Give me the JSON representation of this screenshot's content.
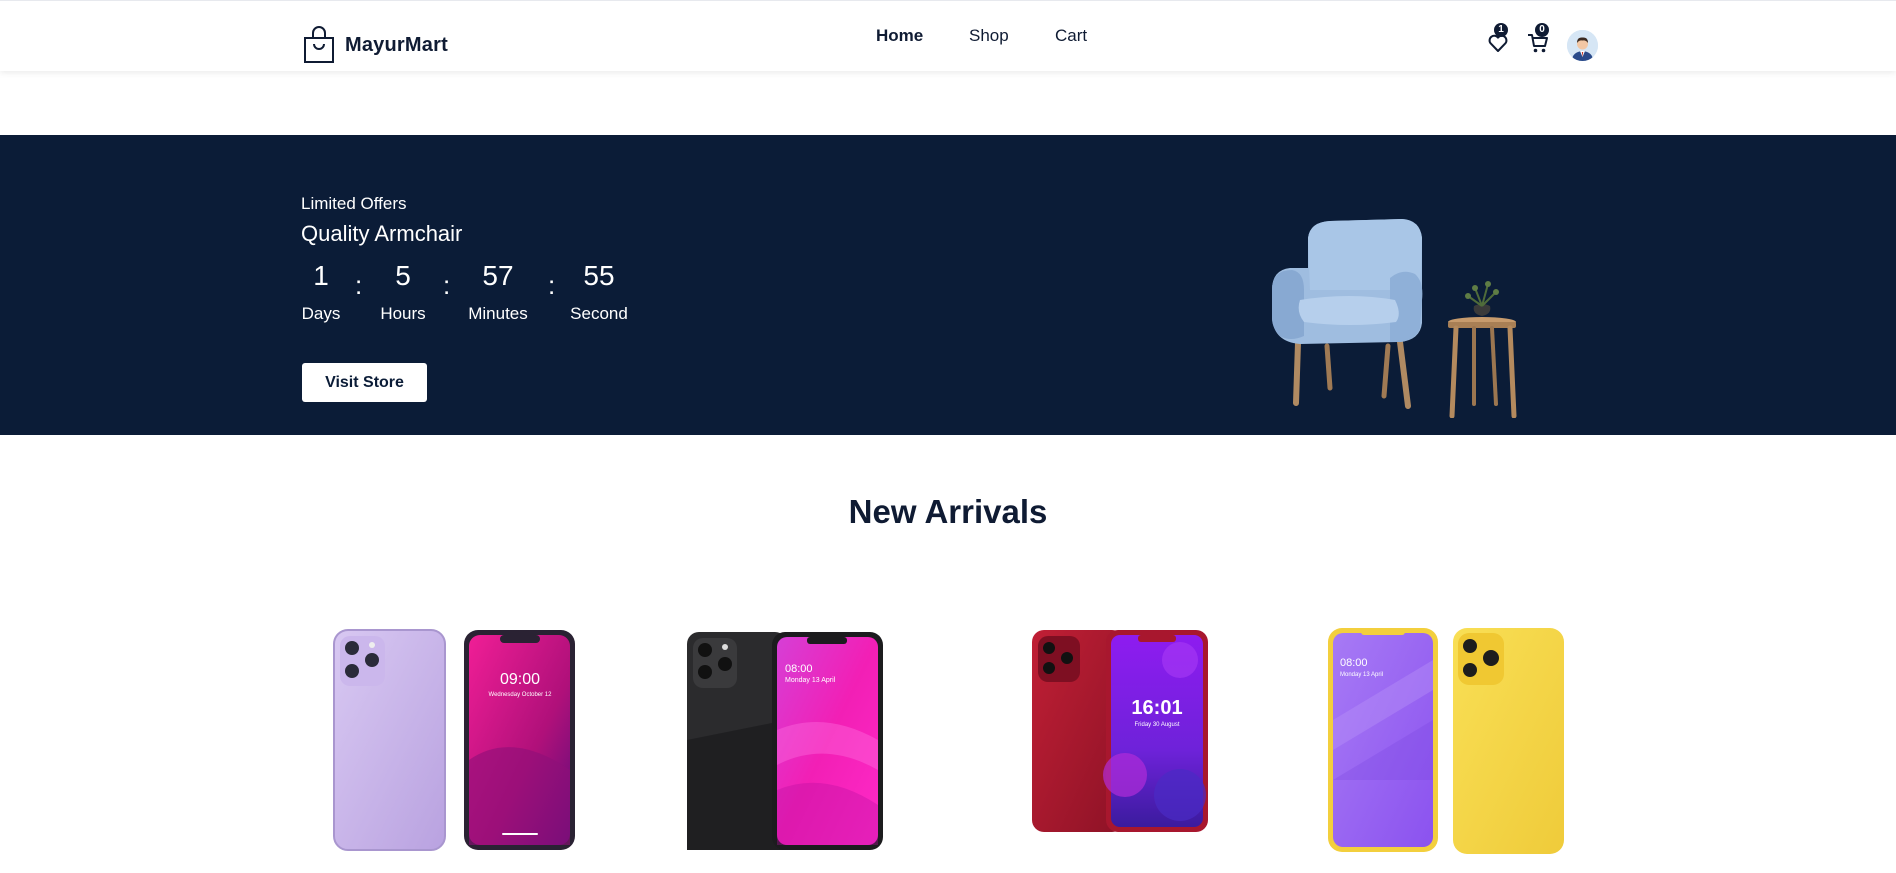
{
  "header": {
    "brand": "MayurMart",
    "nav": [
      "Home",
      "Shop",
      "Cart"
    ],
    "wishlist_count": "1",
    "cart_count": "0"
  },
  "banner": {
    "subtitle": "Limited Offers",
    "title": "Quality Armchair",
    "countdown": [
      {
        "value": "1",
        "label": "Days"
      },
      {
        "value": "5",
        "label": "Hours"
      },
      {
        "value": "57",
        "label": "Minutes"
      },
      {
        "value": "55",
        "label": "Second"
      }
    ],
    "separator": ":",
    "button": "Visit Store"
  },
  "arrivals": {
    "title": "New Arrivals",
    "products": [
      {
        "screen_time": "09:00",
        "screen_date": "Wednesday October 12"
      },
      {
        "screen_time": "08:00",
        "screen_date": "Monday 13 April"
      },
      {
        "screen_time": "16:01",
        "screen_date": "Friday 30 August"
      },
      {
        "screen_time": "08:00",
        "screen_date": "Monday 13 April"
      }
    ]
  },
  "colors": {
    "navy": "#0b1c37",
    "text": "#0f1b33",
    "lavender": "#c9b5ea",
    "magenta": "#e2148c",
    "red": "#a8172e",
    "yellow": "#f6d84a",
    "purple": "#9a63f3"
  }
}
